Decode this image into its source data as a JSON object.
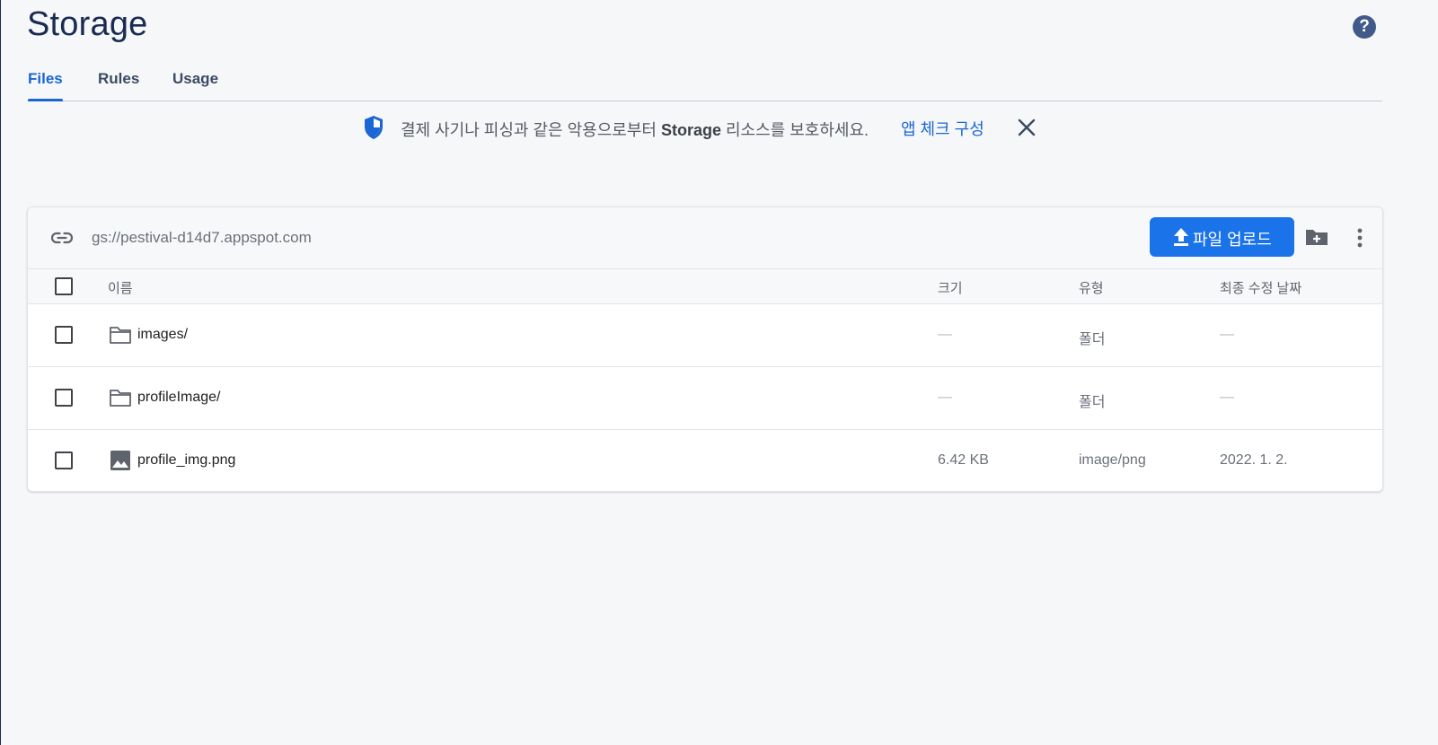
{
  "page": {
    "title": "Storage",
    "help_icon": "help-circle-icon"
  },
  "tabs": [
    {
      "label": "Files",
      "active": true
    },
    {
      "label": "Rules",
      "active": false
    },
    {
      "label": "Usage",
      "active": false
    }
  ],
  "banner": {
    "icon": "shield-icon",
    "text_before": "결제 사기나 피싱과 같은 악용으로부터 ",
    "text_bold": "Storage",
    "text_after": " 리소스를 보호하세요.",
    "link": "앱 체크 구성",
    "close_icon": "close-icon"
  },
  "toolbar": {
    "link_icon": "link-icon",
    "bucket_url": "gs://pestival-d14d7.appspot.com",
    "upload_label": "파일 업로드",
    "upload_icon": "upload-icon",
    "add_folder_icon": "add-folder-icon",
    "more_icon": "more-vert-icon"
  },
  "table": {
    "headers": {
      "name": "이름",
      "size": "크기",
      "type": "유형",
      "modified": "최종 수정 날짜"
    },
    "rows": [
      {
        "icon": "folder-icon",
        "name": "images/",
        "size": "—",
        "type": "폴더",
        "modified": "—"
      },
      {
        "icon": "folder-icon",
        "name": "profileImage/",
        "size": "—",
        "type": "폴더",
        "modified": "—"
      },
      {
        "icon": "image-icon",
        "name": "profile_img.png",
        "size": "6.42 KB",
        "type": "image/png",
        "modified": "2022. 1. 2."
      }
    ]
  },
  "colors": {
    "accent": "#1a73e8",
    "title": "#1a2b52",
    "background": "#f6f7f9"
  }
}
